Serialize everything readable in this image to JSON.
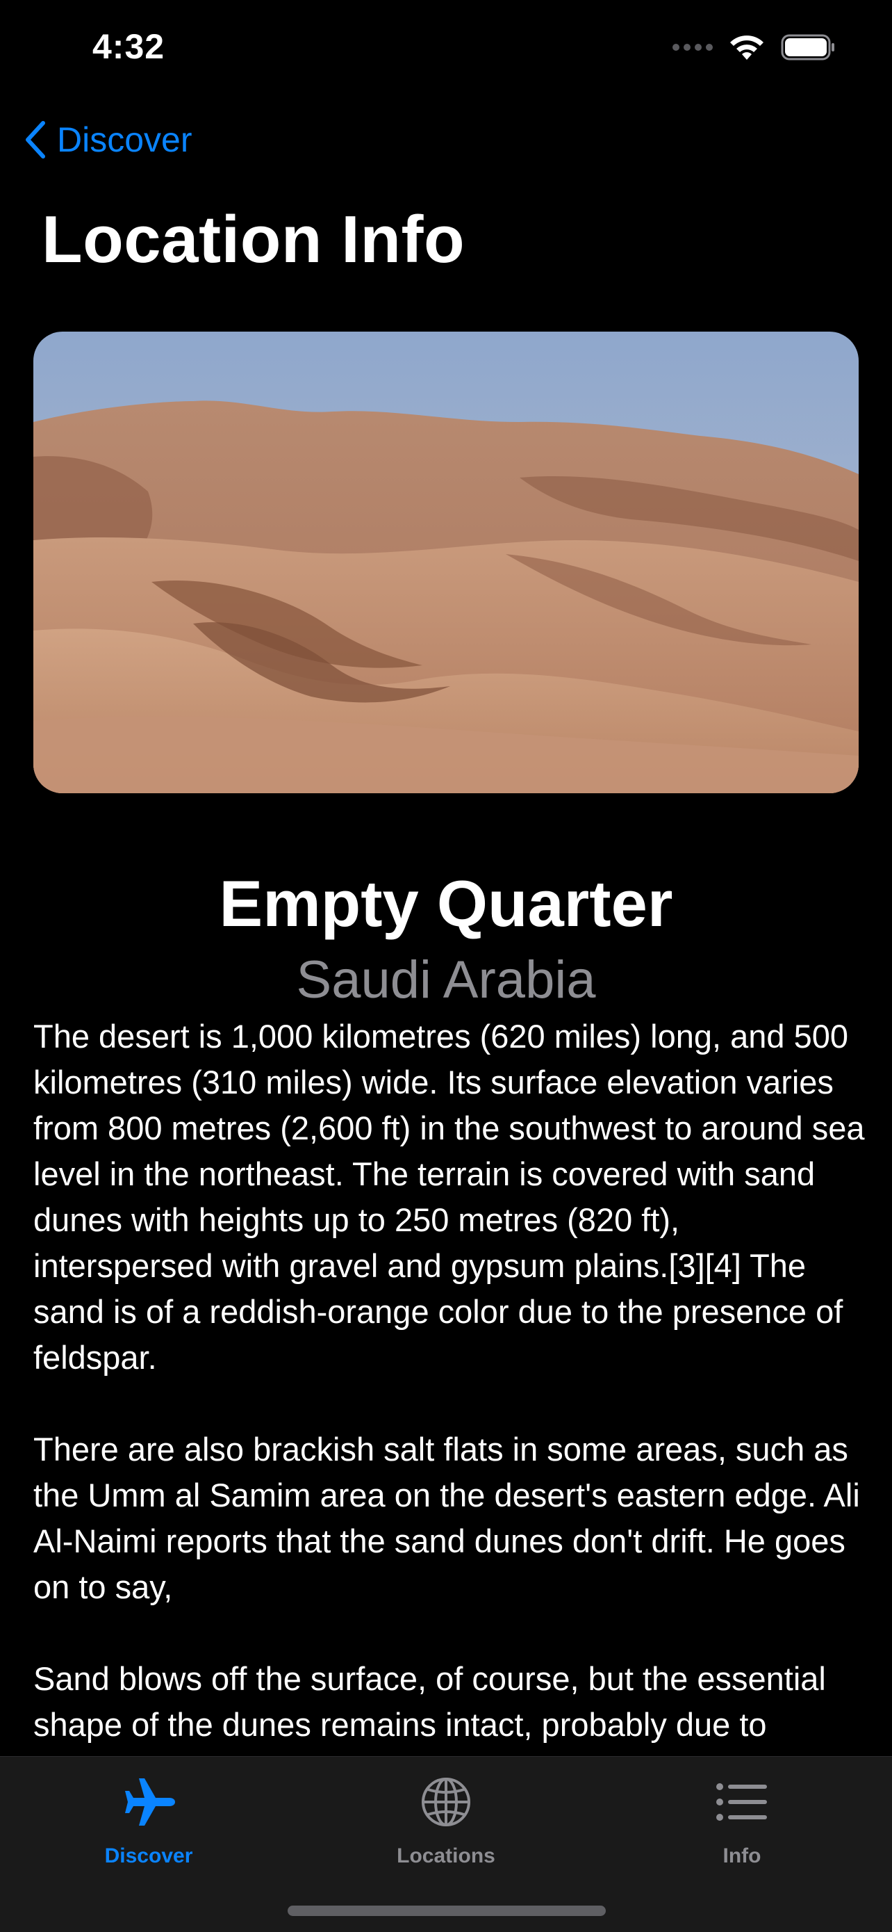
{
  "status_bar": {
    "time": "4:32"
  },
  "nav": {
    "back_label": "Discover",
    "title": "Location Info"
  },
  "location": {
    "name": "Empty Quarter",
    "country": "Saudi Arabia",
    "paragraphs": [
      "The desert is 1,000 kilometres (620 miles) long, and 500 kilometres (310 miles) wide. Its surface elevation varies from 800 metres (2,600 ft) in the southwest to around sea level in the northeast. The terrain is covered with sand dunes with heights up to 250 metres (820 ft), interspersed with gravel and gypsum plains.[3][4] The sand is of a reddish-orange color due to the presence of feldspar.",
      "There are also brackish salt flats in some areas, such as the Umm al Samim area on the desert's eastern edge. Ali Al-Naimi reports that the sand dunes don't drift. He goes on to say,",
      "Sand blows off the surface, of course, but the essential shape of the dunes remains intact, probably due to moisture trapped beneath the surface."
    ]
  },
  "tab_bar": {
    "tabs": [
      {
        "label": "Discover",
        "icon": "airplane-icon",
        "active": true
      },
      {
        "label": "Locations",
        "icon": "globe-icon",
        "active": false
      },
      {
        "label": "Info",
        "icon": "list-icon",
        "active": false
      }
    ]
  },
  "colors": {
    "accent": "#0a84ff",
    "secondary_text": "#8e8e93",
    "background": "#000000",
    "tab_bar_bg": "#1a1a1a"
  }
}
